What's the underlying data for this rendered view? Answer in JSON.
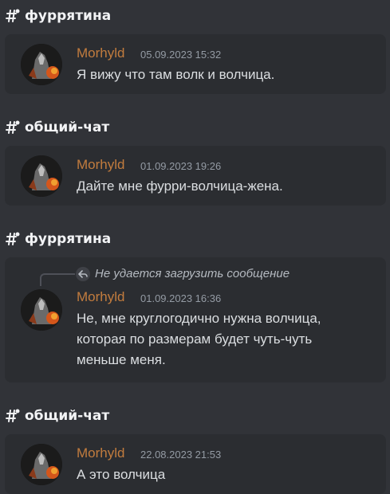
{
  "results": [
    {
      "channel": "фуррятина",
      "author": "Morhyld",
      "timestamp": "05.09.2023 15:32",
      "message": "Я вижу что там волк и волчица."
    },
    {
      "channel": "общий-чат",
      "author": "Morhyld",
      "timestamp": "01.09.2023 19:26",
      "message": "Дайте мне фурри-волчица-жена."
    },
    {
      "channel": "фуррятина",
      "reply_text": "Не удается загрузить сообщение",
      "author": "Morhyld",
      "timestamp": "01.09.2023 16:36",
      "message": "Не, мне круглогодично нужна волчица,\nкоторая по размерам будет чуть-чуть\nменьше меня."
    },
    {
      "channel": "общий-чат",
      "author": "Morhyld",
      "timestamp": "22.08.2023 21:53",
      "message": "А это волчица"
    }
  ],
  "colors": {
    "background": "#313338",
    "card": "#2b2d31",
    "author": "#c27c3e",
    "timestamp": "#949ba4"
  },
  "icons": {
    "channel": "thread-channel-icon",
    "reply": "reply-arrow-icon"
  }
}
